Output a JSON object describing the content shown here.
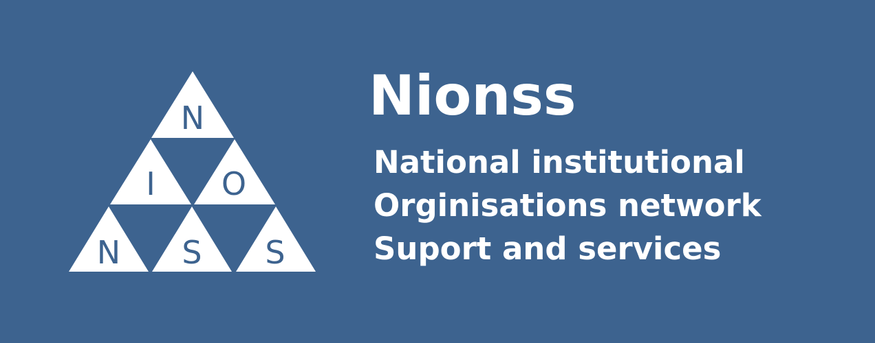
{
  "colors": {
    "background": "#3d638f",
    "foreground": "#ffffff"
  },
  "logo": {
    "letters": {
      "top": "N",
      "middle_left": "I",
      "middle_right": "O",
      "bottom_left": "N",
      "bottom_center": "S",
      "bottom_right": "S"
    }
  },
  "brand": {
    "name": "Nionss"
  },
  "tagline": {
    "line1": "National institutional",
    "line2": "Orginisations network",
    "line3": "Suport and services"
  }
}
